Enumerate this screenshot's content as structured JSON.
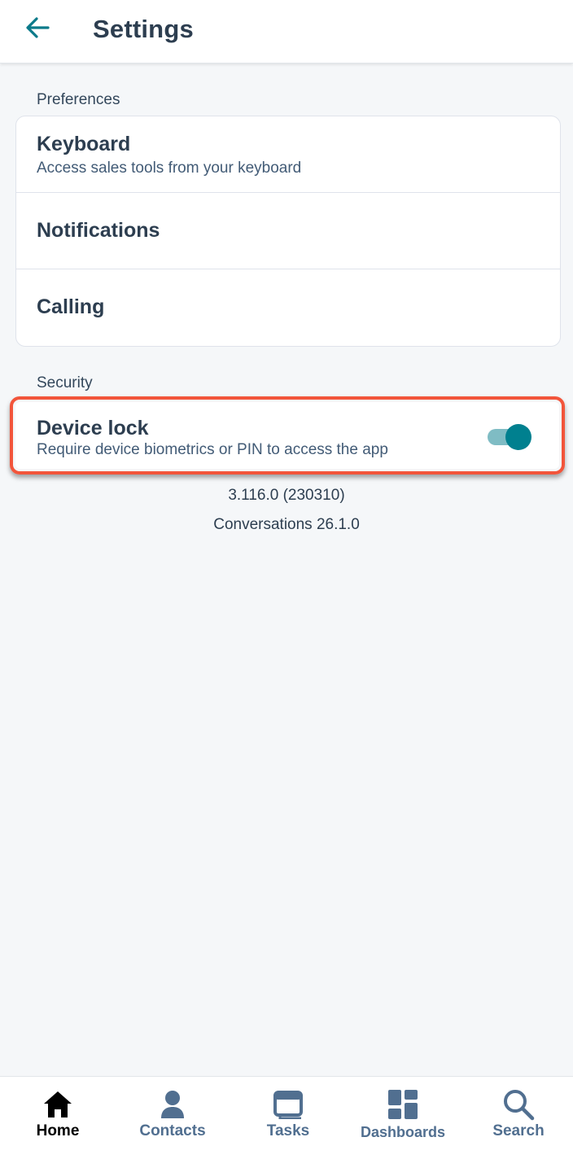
{
  "header": {
    "title": "Settings",
    "back_icon": "arrow-left-icon"
  },
  "preferences": {
    "label": "Preferences",
    "items": [
      {
        "title": "Keyboard",
        "subtitle": "Access sales tools from your keyboard"
      },
      {
        "title": "Notifications"
      },
      {
        "title": "Calling"
      }
    ]
  },
  "security": {
    "label": "Security",
    "device_lock": {
      "title": "Device lock",
      "subtitle": "Require device biometrics or PIN to access the app",
      "enabled": true
    }
  },
  "version": {
    "app": "3.116.0 (230310)",
    "conversations": "Conversations 26.1.0"
  },
  "bottom_nav": [
    {
      "label": "Home",
      "icon": "home-icon",
      "active": true
    },
    {
      "label": "Contacts",
      "icon": "contacts-icon",
      "active": false
    },
    {
      "label": "Tasks",
      "icon": "tasks-icon",
      "active": false
    },
    {
      "label": "Dashboards",
      "icon": "dashboards-icon",
      "active": false
    },
    {
      "label": "Search",
      "icon": "search-icon",
      "active": false
    }
  ],
  "colors": {
    "accent": "#00808f",
    "highlight": "#f2553b",
    "text": "#2d3e50",
    "nav_icon": "#516f90"
  }
}
